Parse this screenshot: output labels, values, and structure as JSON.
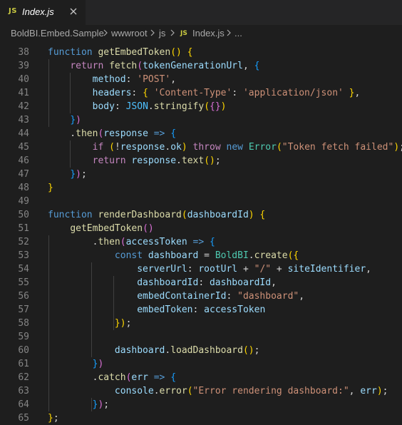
{
  "tab": {
    "badge": "JS",
    "title": "Index.js"
  },
  "breadcrumb": {
    "items": [
      "BoldBI.Embed.Sample",
      "wwwroot",
      "js",
      "Index.js",
      "..."
    ],
    "file_badge": "JS"
  },
  "colors": {
    "editor_bg": "#1e1e1e",
    "keyword": "#569cd6",
    "control": "#c586c0",
    "function": "#dcdcaa",
    "variable": "#9cdcfe",
    "string": "#ce9178",
    "class": "#4ec9b0",
    "bracket_1": "#ffd700",
    "bracket_2": "#da70d6",
    "bracket_3": "#179fff",
    "js_badge": "#cbcb41"
  },
  "code": {
    "lines": [
      {
        "n": "38",
        "t": [
          [
            "kw",
            "function "
          ],
          [
            "fn",
            "getEmbedToken"
          ],
          [
            "b1",
            "() {"
          ]
        ]
      },
      {
        "n": "39",
        "t": [
          [
            "pun",
            "    "
          ],
          [
            "ctl",
            "return "
          ],
          [
            "fn",
            "fetch"
          ],
          [
            "b2",
            "("
          ],
          [
            "var",
            "tokenGenerationUrl"
          ],
          [
            "pun",
            ", "
          ],
          [
            "b3",
            "{"
          ]
        ]
      },
      {
        "n": "40",
        "t": [
          [
            "pun",
            "        "
          ],
          [
            "var",
            "method"
          ],
          [
            "pun",
            ": "
          ],
          [
            "str",
            "'POST'"
          ],
          [
            "pun",
            ","
          ]
        ]
      },
      {
        "n": "41",
        "t": [
          [
            "pun",
            "        "
          ],
          [
            "var",
            "headers"
          ],
          [
            "pun",
            ": "
          ],
          [
            "b1",
            "{ "
          ],
          [
            "str",
            "'Content-Type'"
          ],
          [
            "pun",
            ": "
          ],
          [
            "str",
            "'application/json'"
          ],
          [
            "b1",
            " }"
          ],
          [
            "pun",
            ","
          ]
        ]
      },
      {
        "n": "42",
        "t": [
          [
            "pun",
            "        "
          ],
          [
            "var",
            "body"
          ],
          [
            "pun",
            ": "
          ],
          [
            "const",
            "JSON"
          ],
          [
            "pun",
            "."
          ],
          [
            "fn",
            "stringify"
          ],
          [
            "b1",
            "("
          ],
          [
            "b2",
            "{}"
          ],
          [
            "b1",
            ")"
          ]
        ]
      },
      {
        "n": "43",
        "t": [
          [
            "pun",
            "    "
          ],
          [
            "b3",
            "}"
          ],
          [
            "b2",
            ")"
          ]
        ]
      },
      {
        "n": "44",
        "t": [
          [
            "pun",
            "    ."
          ],
          [
            "fn",
            "then"
          ],
          [
            "b2",
            "("
          ],
          [
            "var",
            "response"
          ],
          [
            "kw",
            " => "
          ],
          [
            "b3",
            "{"
          ]
        ]
      },
      {
        "n": "45",
        "t": [
          [
            "pun",
            "        "
          ],
          [
            "ctl",
            "if "
          ],
          [
            "b1",
            "("
          ],
          [
            "pun",
            "!"
          ],
          [
            "var",
            "response"
          ],
          [
            "pun",
            "."
          ],
          [
            "var",
            "ok"
          ],
          [
            "b1",
            ")"
          ],
          [
            "ctl",
            " throw "
          ],
          [
            "kw",
            "new "
          ],
          [
            "cls",
            "Error"
          ],
          [
            "b1",
            "("
          ],
          [
            "str",
            "\"Token fetch failed\""
          ],
          [
            "b1",
            ")"
          ],
          [
            "pun",
            ";"
          ]
        ]
      },
      {
        "n": "46",
        "t": [
          [
            "pun",
            "        "
          ],
          [
            "ctl",
            "return "
          ],
          [
            "var",
            "response"
          ],
          [
            "pun",
            "."
          ],
          [
            "fn",
            "text"
          ],
          [
            "b1",
            "()"
          ],
          [
            "pun",
            ";"
          ]
        ]
      },
      {
        "n": "47",
        "t": [
          [
            "pun",
            "    "
          ],
          [
            "b3",
            "}"
          ],
          [
            "b2",
            ")"
          ],
          [
            "pun",
            ";"
          ]
        ]
      },
      {
        "n": "48",
        "t": [
          [
            "b1",
            "}"
          ]
        ]
      },
      {
        "n": "49",
        "t": []
      },
      {
        "n": "50",
        "t": [
          [
            "kw",
            "function "
          ],
          [
            "fn",
            "renderDashboard"
          ],
          [
            "b1",
            "("
          ],
          [
            "var",
            "dashboardId"
          ],
          [
            "b1",
            ") {"
          ]
        ]
      },
      {
        "n": "51",
        "t": [
          [
            "pun",
            "    "
          ],
          [
            "fn",
            "getEmbedToken"
          ],
          [
            "b2",
            "()"
          ]
        ]
      },
      {
        "n": "52",
        "t": [
          [
            "pun",
            "        ."
          ],
          [
            "fn",
            "then"
          ],
          [
            "b2",
            "("
          ],
          [
            "var",
            "accessToken"
          ],
          [
            "kw",
            " => "
          ],
          [
            "b3",
            "{"
          ]
        ]
      },
      {
        "n": "53",
        "t": [
          [
            "pun",
            "            "
          ],
          [
            "kw",
            "const "
          ],
          [
            "var",
            "dashboard"
          ],
          [
            "pun",
            " = "
          ],
          [
            "cls",
            "BoldBI"
          ],
          [
            "pun",
            "."
          ],
          [
            "fn",
            "create"
          ],
          [
            "b1",
            "({"
          ]
        ]
      },
      {
        "n": "54",
        "t": [
          [
            "pun",
            "                "
          ],
          [
            "var",
            "serverUrl"
          ],
          [
            "pun",
            ": "
          ],
          [
            "var",
            "rootUrl"
          ],
          [
            "pun",
            " + "
          ],
          [
            "str",
            "\"/\""
          ],
          [
            "pun",
            " + "
          ],
          [
            "var",
            "siteIdentifier"
          ],
          [
            "pun",
            ","
          ]
        ]
      },
      {
        "n": "55",
        "t": [
          [
            "pun",
            "                "
          ],
          [
            "var",
            "dashboardId"
          ],
          [
            "pun",
            ": "
          ],
          [
            "var",
            "dashboardId"
          ],
          [
            "pun",
            ","
          ]
        ]
      },
      {
        "n": "56",
        "t": [
          [
            "pun",
            "                "
          ],
          [
            "var",
            "embedContainerId"
          ],
          [
            "pun",
            ": "
          ],
          [
            "str",
            "\"dashboard\""
          ],
          [
            "pun",
            ","
          ]
        ]
      },
      {
        "n": "57",
        "t": [
          [
            "pun",
            "                "
          ],
          [
            "var",
            "embedToken"
          ],
          [
            "pun",
            ": "
          ],
          [
            "var",
            "accessToken"
          ]
        ]
      },
      {
        "n": "58",
        "t": [
          [
            "pun",
            "            "
          ],
          [
            "b1",
            "})"
          ],
          [
            "pun",
            ";"
          ]
        ]
      },
      {
        "n": "59",
        "t": []
      },
      {
        "n": "60",
        "t": [
          [
            "pun",
            "            "
          ],
          [
            "var",
            "dashboard"
          ],
          [
            "pun",
            "."
          ],
          [
            "fn",
            "loadDashboard"
          ],
          [
            "b1",
            "()"
          ],
          [
            "pun",
            ";"
          ]
        ]
      },
      {
        "n": "61",
        "t": [
          [
            "pun",
            "        "
          ],
          [
            "b3",
            "}"
          ],
          [
            "b2",
            ")"
          ]
        ]
      },
      {
        "n": "62",
        "t": [
          [
            "pun",
            "        ."
          ],
          [
            "fn",
            "catch"
          ],
          [
            "b2",
            "("
          ],
          [
            "var",
            "err"
          ],
          [
            "kw",
            " => "
          ],
          [
            "b3",
            "{"
          ]
        ]
      },
      {
        "n": "63",
        "t": [
          [
            "pun",
            "            "
          ],
          [
            "var",
            "console"
          ],
          [
            "pun",
            "."
          ],
          [
            "fn",
            "error"
          ],
          [
            "b1",
            "("
          ],
          [
            "str",
            "\"Error rendering dashboard:\""
          ],
          [
            "pun",
            ", "
          ],
          [
            "var",
            "err"
          ],
          [
            "b1",
            ")"
          ],
          [
            "pun",
            ";"
          ]
        ]
      },
      {
        "n": "64",
        "t": [
          [
            "pun",
            "        "
          ],
          [
            "b3",
            "}"
          ],
          [
            "b2",
            ")"
          ],
          [
            "pun",
            ";"
          ]
        ]
      },
      {
        "n": "65",
        "t": [
          [
            "b1",
            "}"
          ],
          [
            "pun",
            ";"
          ]
        ]
      }
    ]
  }
}
